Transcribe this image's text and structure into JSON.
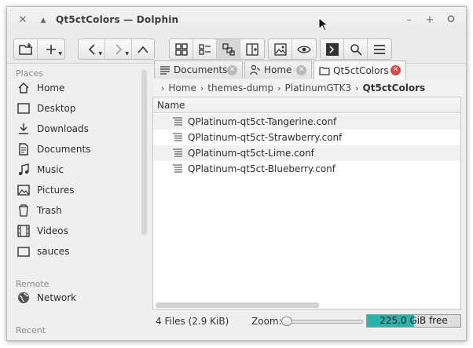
{
  "window": {
    "title": "Qt5ctColors — Dolphin"
  },
  "toolbar": {
    "icons": [
      "new-window-icon",
      "new-folder-icon",
      "back-icon",
      "forward-icon",
      "up-icon",
      "icons-view-icon",
      "details-view-icon",
      "compact-view-icon",
      "split-view-icon",
      "preview-icon",
      "show-hidden-icon",
      "terminal-icon",
      "search-icon",
      "menu-icon"
    ]
  },
  "sidebar": {
    "places_title": "Places",
    "places": [
      {
        "label": "Home",
        "icon": "home-icon"
      },
      {
        "label": "Desktop",
        "icon": "desktop-icon"
      },
      {
        "label": "Downloads",
        "icon": "downloads-icon"
      },
      {
        "label": "Documents",
        "icon": "documents-icon"
      },
      {
        "label": "Music",
        "icon": "music-icon"
      },
      {
        "label": "Pictures",
        "icon": "pictures-icon"
      },
      {
        "label": "Trash",
        "icon": "trash-icon"
      },
      {
        "label": "Videos",
        "icon": "videos-icon"
      },
      {
        "label": "sauces",
        "icon": "folder-icon"
      }
    ],
    "remote_title": "Remote",
    "remote": [
      {
        "label": "Network",
        "icon": "network-icon"
      }
    ],
    "recent_title": "Recent"
  },
  "tabs": [
    {
      "label": "Documents",
      "active": false
    },
    {
      "label": "Home",
      "active": false
    },
    {
      "label": "Qt5ctColors",
      "active": true
    }
  ],
  "breadcrumb": [
    "Home",
    "themes-dump",
    "PlatinumGTK3",
    "Qt5ctColors"
  ],
  "file_view": {
    "column_name": "Name",
    "files": [
      "QPlatinum-qt5ct-Tangerine.conf",
      "QPlatinum-qt5ct-Strawberry.conf",
      "QPlatinum-qt5ct-Lime.conf",
      "QPlatinum-qt5ct-Blueberry.conf"
    ]
  },
  "status": {
    "summary": "4 Files (2.9 KiB)",
    "zoom_label": "Zoom:",
    "free_space": "225.0 GiB free",
    "used_fraction": 0.5
  },
  "colors": {
    "accent": "#27b3ae",
    "close_tab": "#e04646"
  }
}
